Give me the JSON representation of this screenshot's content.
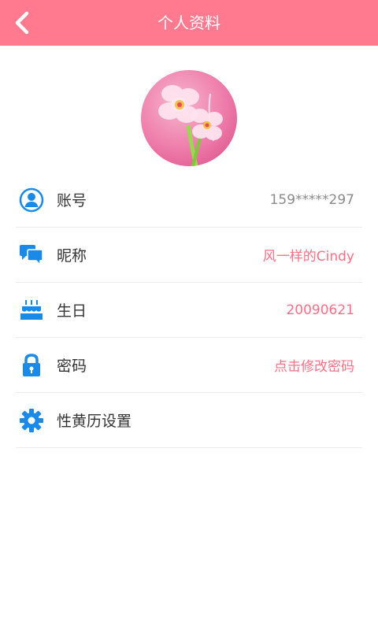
{
  "header": {
    "title": "个人资料",
    "back_icon": "chevron-left-icon"
  },
  "avatar": {
    "icon": "flower-avatar"
  },
  "colors": {
    "header_bg": "#ff7a8e",
    "icon_blue": "#1a8ae8",
    "value_pink": "#ff6f86",
    "value_gray": "#8a8a8a"
  },
  "profile": {
    "account": {
      "label": "账号",
      "value": "159*****297",
      "icon": "user-icon"
    },
    "nickname": {
      "label": "昵称",
      "value": "风一样的Cindy",
      "icon": "chat-icon"
    },
    "birthday": {
      "label": "生日",
      "value": "20090621",
      "icon": "cake-icon"
    },
    "password": {
      "label": "密码",
      "value": "点击修改密码",
      "icon": "lock-icon"
    },
    "calendar": {
      "label": "性黄历设置",
      "icon": "gear-icon"
    }
  }
}
